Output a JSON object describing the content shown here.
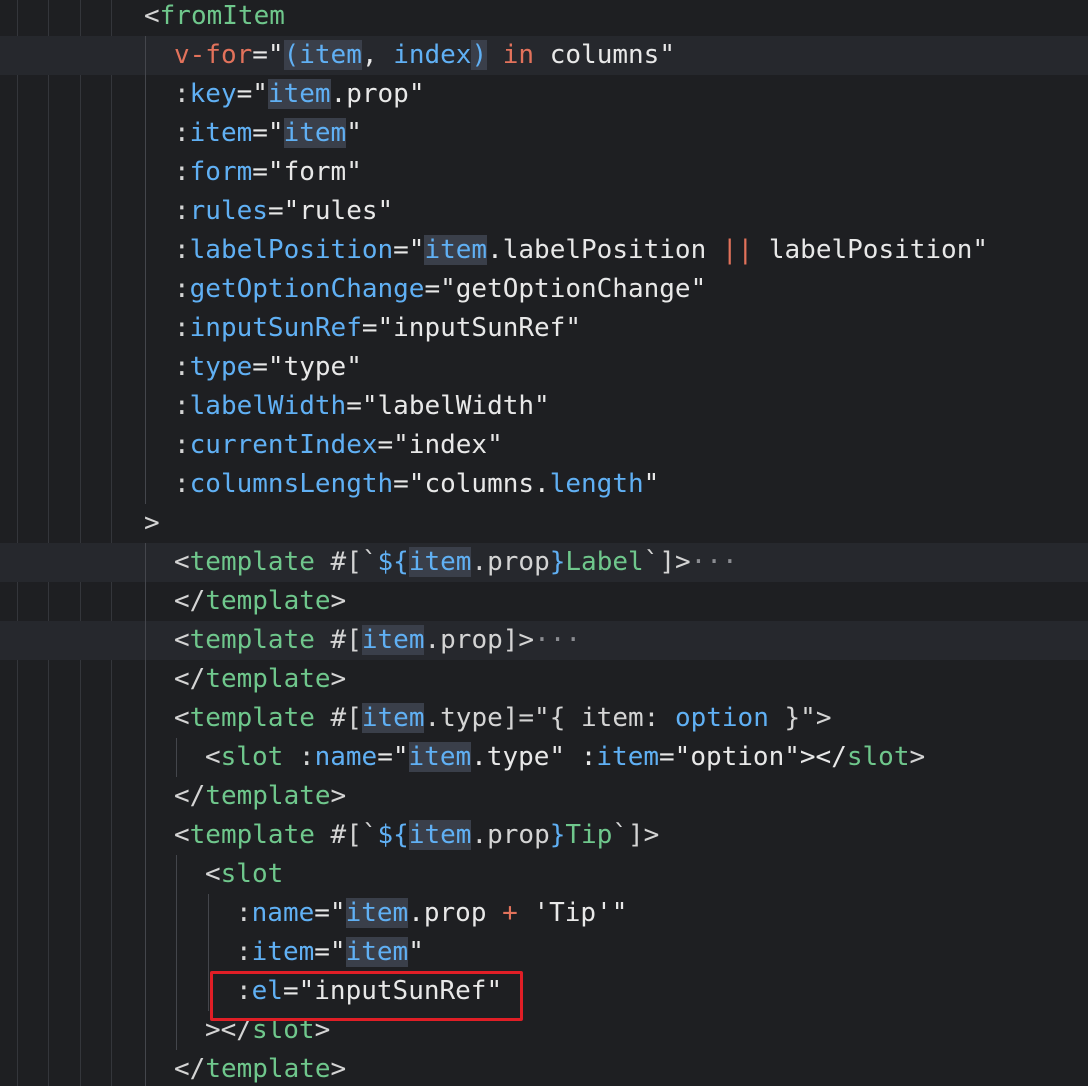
{
  "editor": {
    "lines": [
      {
        "indent": 144,
        "hl": false,
        "tokens": [
          [
            "<",
            "pun"
          ],
          [
            "fromItem",
            "tag"
          ]
        ]
      },
      {
        "indent": 174,
        "hl": true,
        "tokens": [
          [
            "v-for",
            "dir"
          ],
          [
            "=\"",
            "str"
          ],
          [
            "(",
            "occb"
          ],
          [
            "item",
            "occ"
          ],
          [
            ", ",
            "str"
          ],
          [
            "index",
            "prop"
          ],
          [
            ")",
            "occb"
          ],
          [
            " in ",
            "kw"
          ],
          [
            "columns\"",
            "str"
          ]
        ]
      },
      {
        "indent": 174,
        "hl": false,
        "tokens": [
          [
            ":",
            "pun"
          ],
          [
            "key",
            "attr"
          ],
          [
            "=\"",
            "str"
          ],
          [
            "item",
            "occ"
          ],
          [
            ".prop\"",
            "str"
          ]
        ]
      },
      {
        "indent": 174,
        "hl": false,
        "tokens": [
          [
            ":",
            "pun"
          ],
          [
            "item",
            "attr"
          ],
          [
            "=\"",
            "str"
          ],
          [
            "item",
            "occ"
          ],
          [
            "\"",
            "str"
          ]
        ]
      },
      {
        "indent": 174,
        "hl": false,
        "tokens": [
          [
            ":",
            "pun"
          ],
          [
            "form",
            "attr"
          ],
          [
            "=\"form\"",
            "str"
          ]
        ]
      },
      {
        "indent": 174,
        "hl": false,
        "tokens": [
          [
            ":",
            "pun"
          ],
          [
            "rules",
            "attr"
          ],
          [
            "=\"rules\"",
            "str"
          ]
        ]
      },
      {
        "indent": 174,
        "hl": false,
        "tokens": [
          [
            ":",
            "pun"
          ],
          [
            "labelPosition",
            "attr"
          ],
          [
            "=\"",
            "str"
          ],
          [
            "item",
            "occ"
          ],
          [
            ".labelPosition ",
            "str"
          ],
          [
            "||",
            "op"
          ],
          [
            " labelPosition\"",
            "str"
          ]
        ]
      },
      {
        "indent": 174,
        "hl": false,
        "tokens": [
          [
            ":",
            "pun"
          ],
          [
            "getOptionChange",
            "attr"
          ],
          [
            "=\"getOptionChange\"",
            "str"
          ]
        ]
      },
      {
        "indent": 174,
        "hl": false,
        "tokens": [
          [
            ":",
            "pun"
          ],
          [
            "inputSunRef",
            "attr"
          ],
          [
            "=\"inputSunRef\"",
            "str"
          ]
        ]
      },
      {
        "indent": 174,
        "hl": false,
        "tokens": [
          [
            ":",
            "pun"
          ],
          [
            "type",
            "attr"
          ],
          [
            "=\"type\"",
            "str"
          ]
        ]
      },
      {
        "indent": 174,
        "hl": false,
        "tokens": [
          [
            ":",
            "pun"
          ],
          [
            "labelWidth",
            "attr"
          ],
          [
            "=\"labelWidth\"",
            "str"
          ]
        ]
      },
      {
        "indent": 174,
        "hl": false,
        "tokens": [
          [
            ":",
            "pun"
          ],
          [
            "currentIndex",
            "attr"
          ],
          [
            "=\"index\"",
            "str"
          ]
        ]
      },
      {
        "indent": 174,
        "hl": false,
        "tokens": [
          [
            ":",
            "pun"
          ],
          [
            "columnsLength",
            "attr"
          ],
          [
            "=\"columns.",
            "str"
          ],
          [
            "length",
            "prop"
          ],
          [
            "\"",
            "str"
          ]
        ]
      },
      {
        "indent": 144,
        "hl": false,
        "tokens": [
          [
            ">",
            "pun"
          ]
        ]
      },
      {
        "indent": 174,
        "hl": true,
        "tokens": [
          [
            "<",
            "pun"
          ],
          [
            "template",
            "tag"
          ],
          [
            " #[`",
            "pun"
          ],
          [
            "${",
            "sym"
          ],
          [
            "item",
            "occ"
          ],
          [
            ".prop",
            "var"
          ],
          [
            "}",
            "sym"
          ],
          [
            "Label",
            "tag"
          ],
          [
            "`]>",
            "pun"
          ],
          [
            "···",
            "fold"
          ]
        ]
      },
      {
        "indent": 174,
        "hl": false,
        "tokens": [
          [
            "</",
            "pun"
          ],
          [
            "template",
            "tag"
          ],
          [
            ">",
            "pun"
          ]
        ]
      },
      {
        "indent": 174,
        "hl": true,
        "tokens": [
          [
            "<",
            "pun"
          ],
          [
            "template",
            "tag"
          ],
          [
            " #[",
            "pun"
          ],
          [
            "item",
            "occ"
          ],
          [
            ".prop]>",
            "var"
          ],
          [
            "···",
            "fold"
          ]
        ]
      },
      {
        "indent": 174,
        "hl": false,
        "tokens": [
          [
            "</",
            "pun"
          ],
          [
            "template",
            "tag"
          ],
          [
            ">",
            "pun"
          ]
        ]
      },
      {
        "indent": 174,
        "hl": false,
        "tokens": [
          [
            "<",
            "pun"
          ],
          [
            "template",
            "tag"
          ],
          [
            " #[",
            "pun"
          ],
          [
            "item",
            "occ"
          ],
          [
            ".type]=\"{ item: ",
            "var"
          ],
          [
            "option",
            "prop"
          ],
          [
            " }\">",
            "var"
          ]
        ]
      },
      {
        "indent": 205,
        "hl": false,
        "tokens": [
          [
            "<",
            "pun"
          ],
          [
            "slot",
            "tag"
          ],
          [
            " :",
            "pun"
          ],
          [
            "name",
            "attr"
          ],
          [
            "=\"",
            "str"
          ],
          [
            "item",
            "occ"
          ],
          [
            ".type\" :",
            "str"
          ],
          [
            "item",
            "attr"
          ],
          [
            "=\"option\"></",
            "str"
          ],
          [
            "slot",
            "tag"
          ],
          [
            ">",
            "pun"
          ]
        ]
      },
      {
        "indent": 174,
        "hl": false,
        "tokens": [
          [
            "</",
            "pun"
          ],
          [
            "template",
            "tag"
          ],
          [
            ">",
            "pun"
          ]
        ]
      },
      {
        "indent": 174,
        "hl": false,
        "tokens": [
          [
            "<",
            "pun"
          ],
          [
            "template",
            "tag"
          ],
          [
            " #[`",
            "pun"
          ],
          [
            "${",
            "sym"
          ],
          [
            "item",
            "occ"
          ],
          [
            ".prop",
            "var"
          ],
          [
            "}",
            "sym"
          ],
          [
            "Tip",
            "tag"
          ],
          [
            "`]>",
            "pun"
          ]
        ]
      },
      {
        "indent": 205,
        "hl": false,
        "tokens": [
          [
            "<",
            "pun"
          ],
          [
            "slot",
            "tag"
          ]
        ]
      },
      {
        "indent": 236,
        "hl": false,
        "tokens": [
          [
            ":",
            "pun"
          ],
          [
            "name",
            "attr"
          ],
          [
            "=\"",
            "str"
          ],
          [
            "item",
            "occ"
          ],
          [
            ".prop ",
            "str"
          ],
          [
            "+",
            "op"
          ],
          [
            " 'Tip'\"",
            "str"
          ]
        ]
      },
      {
        "indent": 236,
        "hl": false,
        "tokens": [
          [
            ":",
            "pun"
          ],
          [
            "item",
            "attr"
          ],
          [
            "=\"",
            "str"
          ],
          [
            "item",
            "occ"
          ],
          [
            "\"",
            "str"
          ]
        ]
      },
      {
        "indent": 236,
        "hl": false,
        "tokens": [
          [
            ":",
            "pun"
          ],
          [
            "el",
            "attr"
          ],
          [
            "=\"inputSunRef\"",
            "str"
          ]
        ]
      },
      {
        "indent": 205,
        "hl": false,
        "tokens": [
          [
            "></",
            "pun"
          ],
          [
            "slot",
            "tag"
          ],
          [
            ">",
            "pun"
          ]
        ]
      },
      {
        "indent": 174,
        "hl": false,
        "tokens": [
          [
            "</",
            "pun"
          ],
          [
            "template",
            "tag"
          ],
          [
            ">",
            "pun"
          ]
        ]
      }
    ]
  },
  "colors": {
    "background": "#1e1f22",
    "tag": "#6fc78c",
    "attribute": "#60b0f4",
    "directive": "#e2725b",
    "string": "#e8e8e8",
    "highlight_box": "#e01e26"
  }
}
